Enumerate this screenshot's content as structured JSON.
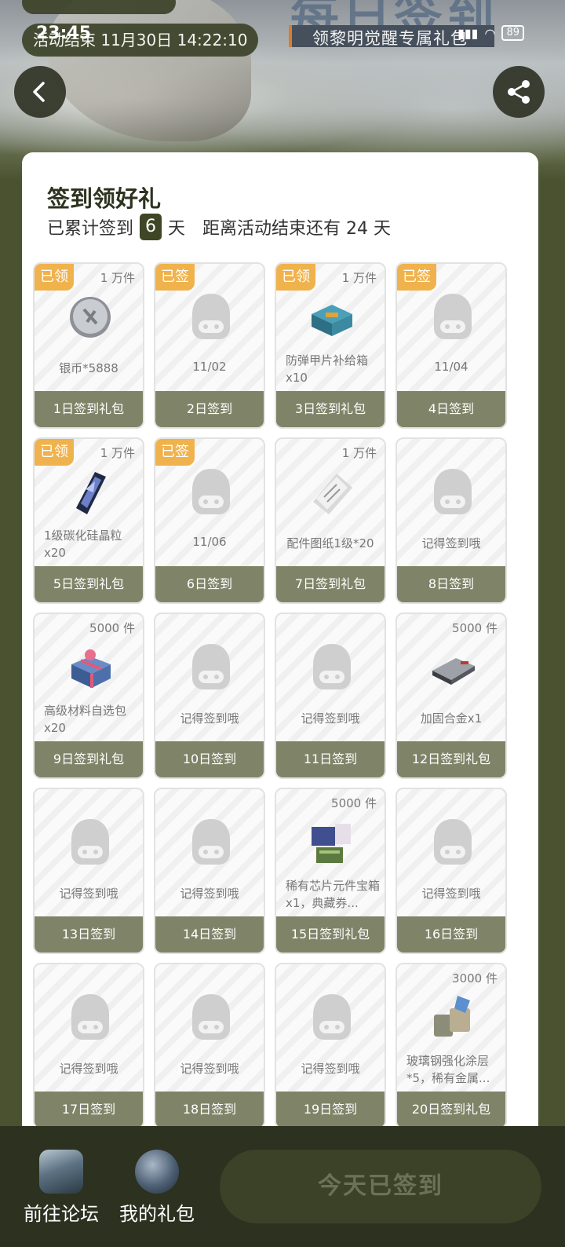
{
  "status_bar": {
    "time": "23:45",
    "battery": "89"
  },
  "header": {
    "banner_title": "每日签到",
    "banner_subtitle": "领黎明觉醒专属礼包",
    "countdown": "活动结束 11月30日 14:22:10"
  },
  "card": {
    "title": "签到领好礼",
    "summary_prefix": "已累计签到",
    "days_signed": "6",
    "summary_unit": "天",
    "summary_remaining": "距离活动结束还有 24 天"
  },
  "days": [
    {
      "badge": "已领",
      "qty": "1 万件",
      "desc": "银币*5888",
      "label": "1日签到礼包",
      "icon": "silver-coin-icon"
    },
    {
      "badge": "已签",
      "qty": "",
      "desc": "11/02",
      "label": "2日签到",
      "icon": "placeholder-icon"
    },
    {
      "badge": "已领",
      "qty": "1 万件",
      "desc": "防弹甲片补给箱x10",
      "label": "3日签到礼包",
      "icon": "supply-box-icon"
    },
    {
      "badge": "已签",
      "qty": "",
      "desc": "11/04",
      "label": "4日签到",
      "icon": "placeholder-icon"
    },
    {
      "badge": "已领",
      "qty": "1 万件",
      "desc": "1级碳化硅晶粒x20",
      "label": "5日签到礼包",
      "icon": "crystal-icon"
    },
    {
      "badge": "已签",
      "qty": "",
      "desc": "11/06",
      "label": "6日签到",
      "icon": "placeholder-icon"
    },
    {
      "badge": "",
      "qty": "1 万件",
      "desc": "配件图纸1级*20",
      "label": "7日签到礼包",
      "icon": "blueprint-icon"
    },
    {
      "badge": "",
      "qty": "",
      "desc": "记得签到哦",
      "label": "8日签到",
      "icon": "placeholder-icon"
    },
    {
      "badge": "",
      "qty": "5000 件",
      "desc": "高级材料自选包x20",
      "label": "9日签到礼包",
      "icon": "gift-box-icon"
    },
    {
      "badge": "",
      "qty": "",
      "desc": "记得签到哦",
      "label": "10日签到",
      "icon": "placeholder-icon"
    },
    {
      "badge": "",
      "qty": "",
      "desc": "记得签到哦",
      "label": "11日签到",
      "icon": "placeholder-icon"
    },
    {
      "badge": "",
      "qty": "5000 件",
      "desc": "加固合金x1",
      "label": "12日签到礼包",
      "icon": "alloy-icon"
    },
    {
      "badge": "",
      "qty": "",
      "desc": "记得签到哦",
      "label": "13日签到",
      "icon": "placeholder-icon"
    },
    {
      "badge": "",
      "qty": "",
      "desc": "记得签到哦",
      "label": "14日签到",
      "icon": "placeholder-icon"
    },
    {
      "badge": "",
      "qty": "5000 件",
      "desc": "稀有芯片元件宝箱x1，典藏券...",
      "label": "15日签到礼包",
      "icon": "chip-chest-icon"
    },
    {
      "badge": "",
      "qty": "",
      "desc": "记得签到哦",
      "label": "16日签到",
      "icon": "placeholder-icon"
    },
    {
      "badge": "",
      "qty": "",
      "desc": "记得签到哦",
      "label": "17日签到",
      "icon": "placeholder-icon"
    },
    {
      "badge": "",
      "qty": "",
      "desc": "记得签到哦",
      "label": "18日签到",
      "icon": "placeholder-icon"
    },
    {
      "badge": "",
      "qty": "",
      "desc": "记得签到哦",
      "label": "19日签到",
      "icon": "placeholder-icon"
    },
    {
      "badge": "",
      "qty": "3000 件",
      "desc": "玻璃钢强化涂层*5，稀有金属...",
      "label": "20日签到礼包",
      "icon": "coating-icon"
    }
  ],
  "bottom": {
    "forum_label": "前往论坛",
    "gifts_label": "我的礼包",
    "signed_button": "今天已签到"
  },
  "colors": {
    "accent": "#3e4626",
    "badge": "#f0b24c",
    "footer": "#7f8468"
  }
}
